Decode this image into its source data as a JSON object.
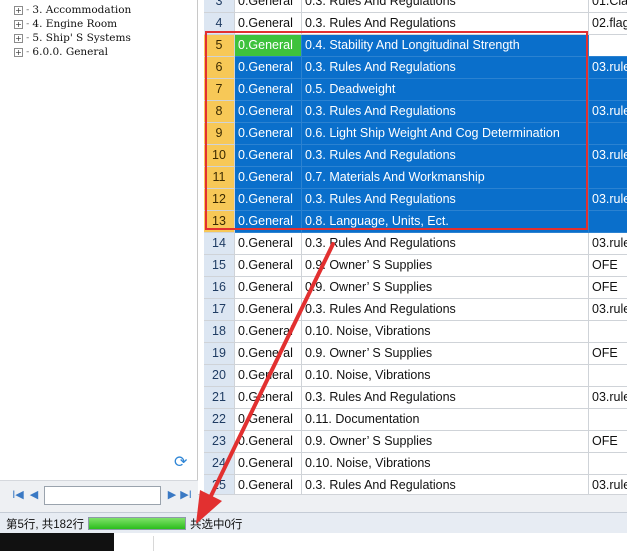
{
  "tree": {
    "nodes": [
      {
        "expander": "+",
        "label": "3. Accommodation"
      },
      {
        "expander": "+",
        "label": "4. Engine Room"
      },
      {
        "expander": "+",
        "label": "5. Ship' S Systems"
      },
      {
        "expander": "+",
        "label": "6.0.0. General"
      }
    ]
  },
  "pager": {
    "first": "I◀",
    "prev": "◀",
    "next": "▶",
    "last": "▶I",
    "input_value": ""
  },
  "grid": {
    "rows": [
      {
        "num": "3",
        "cat": "0.General",
        "sub": "0.3. Rules And Regulations",
        "ref": "01.Cla"
      },
      {
        "num": "4",
        "cat": "0.General",
        "sub": "0.3. Rules And Regulations",
        "ref": "02.flag"
      },
      {
        "num": "5",
        "cat": "0.General",
        "sub": "0.4. Stability And Longitudinal Strength",
        "ref": ""
      },
      {
        "num": "6",
        "cat": "0.General",
        "sub": "0.3. Rules And Regulations",
        "ref": "03.rule"
      },
      {
        "num": "7",
        "cat": "0.General",
        "sub": "0.5. Deadweight",
        "ref": ""
      },
      {
        "num": "8",
        "cat": "0.General",
        "sub": "0.3. Rules And Regulations",
        "ref": "03.rule"
      },
      {
        "num": "9",
        "cat": "0.General",
        "sub": "0.6. Light Ship Weight And Cog Determination",
        "ref": ""
      },
      {
        "num": "10",
        "cat": "0.General",
        "sub": "0.3. Rules And Regulations",
        "ref": "03.rule"
      },
      {
        "num": "11",
        "cat": "0.General",
        "sub": "0.7. Materials And Workmanship",
        "ref": ""
      },
      {
        "num": "12",
        "cat": "0.General",
        "sub": "0.3. Rules And Regulations",
        "ref": "03.rule"
      },
      {
        "num": "13",
        "cat": "0.General",
        "sub": "0.8. Language, Units, Ect.",
        "ref": ""
      },
      {
        "num": "14",
        "cat": "0.General",
        "sub": "0.3. Rules And Regulations",
        "ref": "03.rule"
      },
      {
        "num": "15",
        "cat": "0.General",
        "sub": "0.9. Owner’ S Supplies",
        "ref": "OFE"
      },
      {
        "num": "16",
        "cat": "0.General",
        "sub": "0.9. Owner’ S Supplies",
        "ref": "OFE"
      },
      {
        "num": "17",
        "cat": "0.General",
        "sub": "0.3. Rules And Regulations",
        "ref": "03.rule"
      },
      {
        "num": "18",
        "cat": "0.General",
        "sub": "0.10. Noise, Vibrations",
        "ref": ""
      },
      {
        "num": "19",
        "cat": "0.General",
        "sub": "0.9. Owner’ S Supplies",
        "ref": "OFE"
      },
      {
        "num": "20",
        "cat": "0.General",
        "sub": "0.10. Noise, Vibrations",
        "ref": ""
      },
      {
        "num": "21",
        "cat": "0.General",
        "sub": "0.3. Rules And Regulations",
        "ref": "03.rule"
      },
      {
        "num": "22",
        "cat": "0.General",
        "sub": "0.11. Documentation",
        "ref": ""
      },
      {
        "num": "23",
        "cat": "0.General",
        "sub": "0.9. Owner’ S Supplies",
        "ref": "OFE"
      },
      {
        "num": "24",
        "cat": "0.General",
        "sub": "0.10. Noise, Vibrations",
        "ref": ""
      },
      {
        "num": "25",
        "cat": "0.General",
        "sub": "0.3. Rules And Regulations",
        "ref": "03.rule"
      }
    ],
    "close_glyph": "×"
  },
  "status": {
    "left": "第5行, 共182行",
    "progress": 1.0,
    "right": "共选中0行"
  },
  "colors": {
    "selection_blue": "#0a6fcb",
    "active_cell_green": "#3ec23c",
    "row_header_selected": "#f7c857",
    "annotation_red": "#e23030"
  }
}
